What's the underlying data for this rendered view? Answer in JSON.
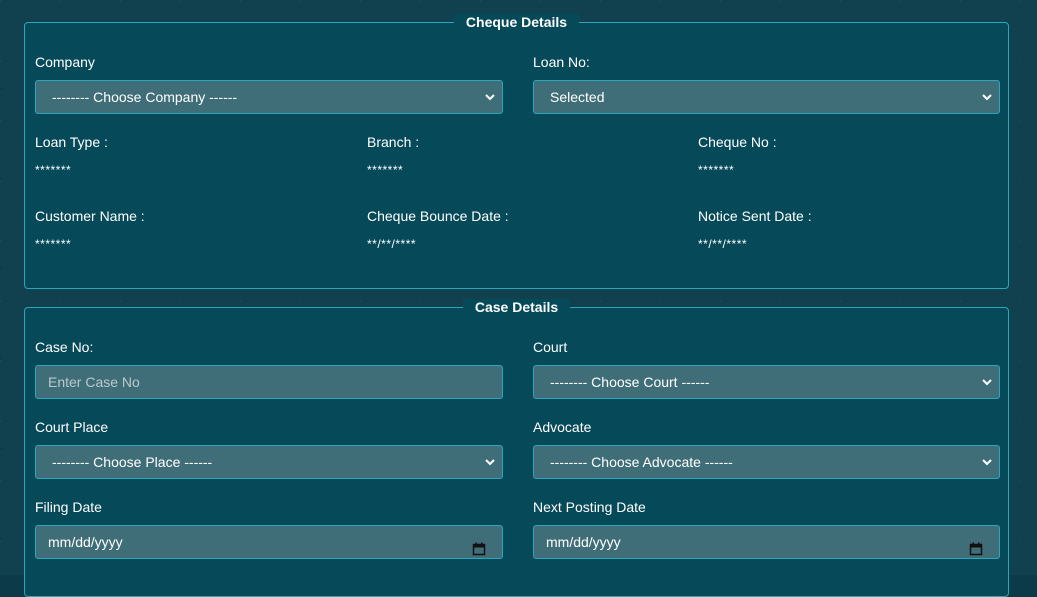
{
  "cheque_details": {
    "legend": "Cheque Details",
    "company_label": "Company",
    "company_value": "-------- Choose Company ------",
    "loan_no_label": "Loan No:",
    "loan_no_value": "Selected",
    "loan_type_label": "Loan Type :",
    "loan_type_value": "*******",
    "branch_label": "Branch :",
    "branch_value": "*******",
    "cheque_no_label": "Cheque No :",
    "cheque_no_value": "*******",
    "customer_name_label": "Customer Name :",
    "customer_name_value": "*******",
    "cheque_bounce_date_label": "Cheque Bounce Date :",
    "cheque_bounce_date_value": "**/**/****",
    "notice_sent_date_label": "Notice Sent Date :",
    "notice_sent_date_value": "**/**/****"
  },
  "case_details": {
    "legend": "Case Details",
    "case_no_label": "Case No:",
    "case_no_placeholder": "Enter Case No",
    "court_label": "Court",
    "court_value": "-------- Choose Court ------",
    "court_place_label": "Court Place",
    "court_place_value": "-------- Choose Place ------",
    "advocate_label": "Advocate",
    "advocate_value": "-------- Choose Advocate ------",
    "filing_date_label": "Filing Date",
    "filing_date_value": "mm/dd/yyyy",
    "next_posting_date_label": "Next Posting Date",
    "next_posting_date_value": "mm/dd/yyyy"
  }
}
